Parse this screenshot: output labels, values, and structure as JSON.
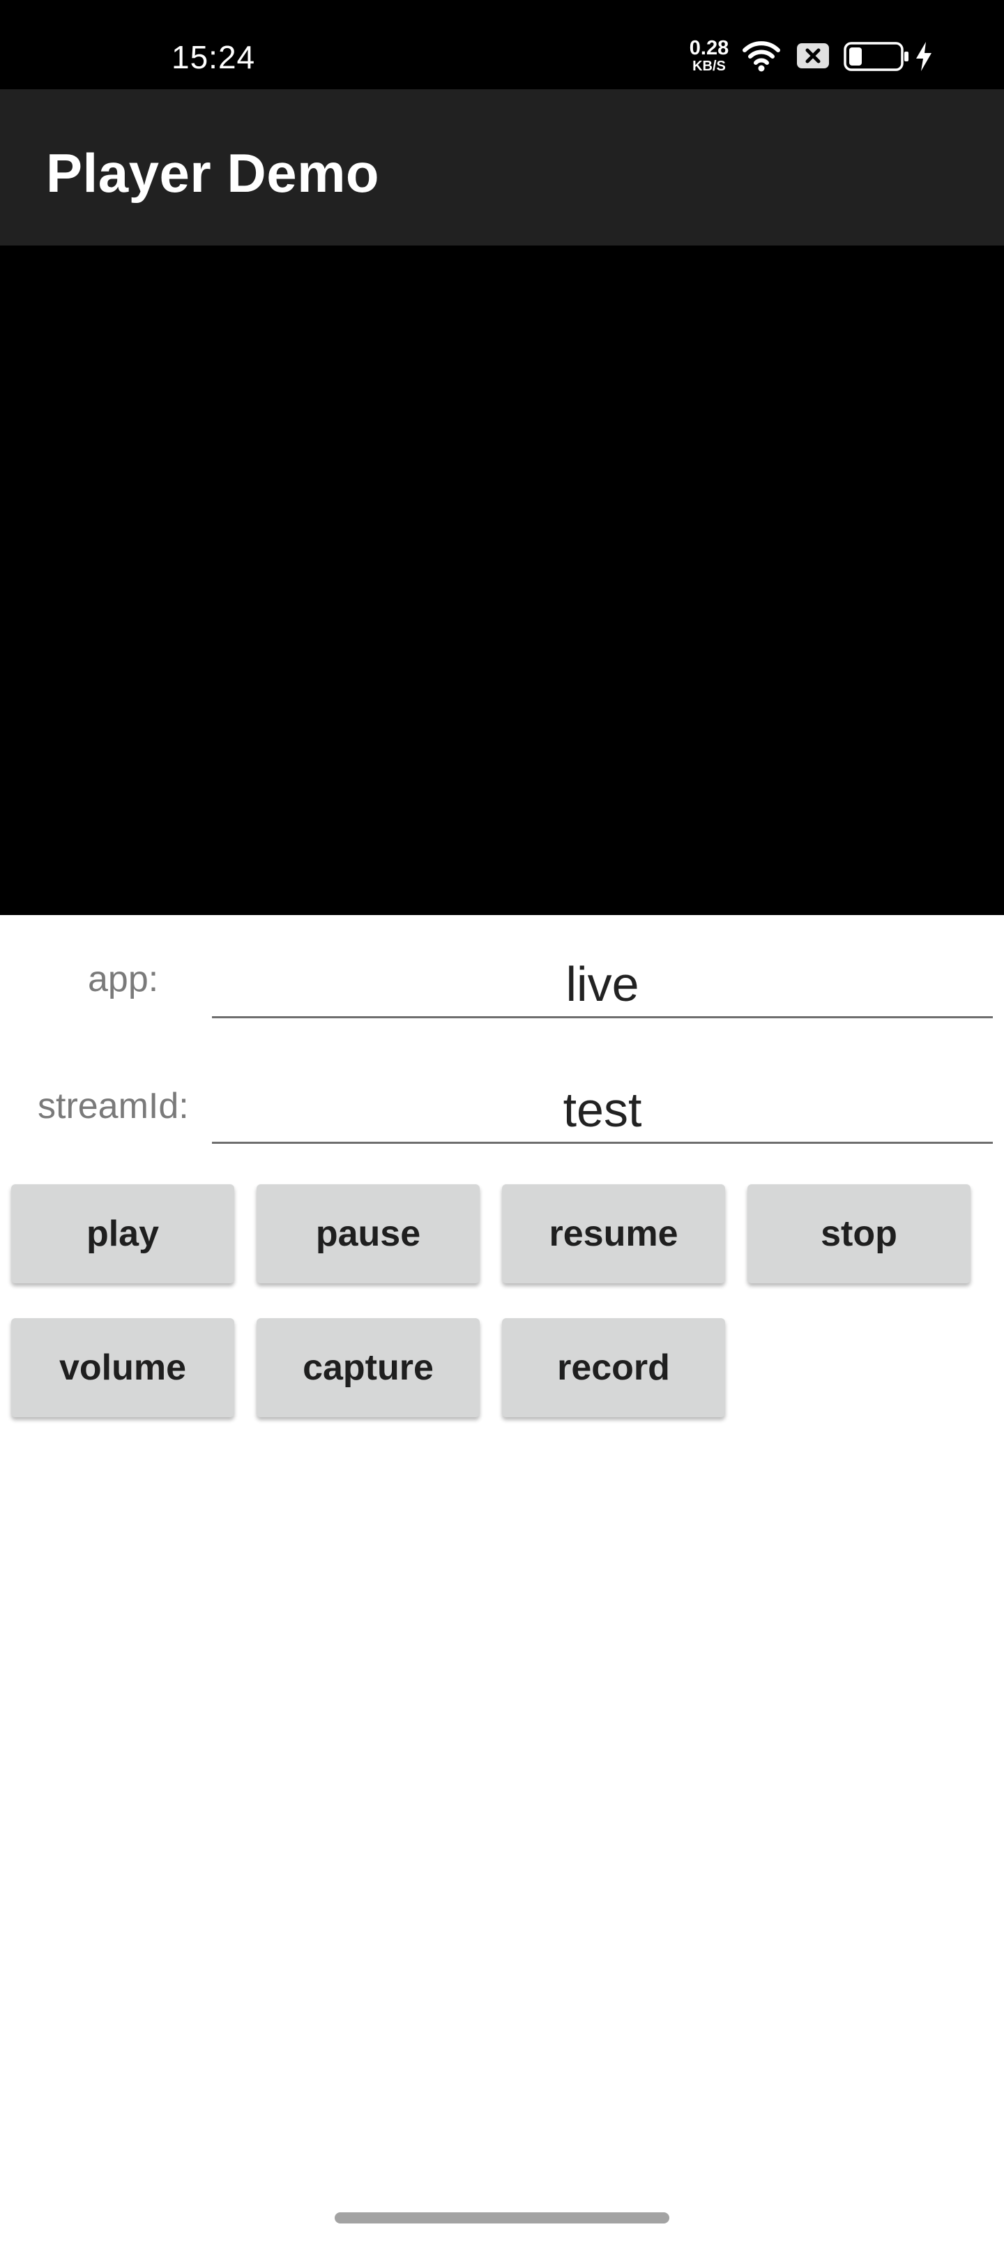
{
  "status_bar": {
    "time": "15:24",
    "net_speed_value": "0.28",
    "net_speed_unit": "KB/S",
    "icons": [
      "wifi-icon",
      "x-icon",
      "battery-icon",
      "charging-bolt-icon"
    ],
    "battery_level": 0.25
  },
  "app_bar": {
    "title": "Player Demo"
  },
  "form": {
    "app_label": "app:",
    "app_value": "live",
    "stream_label": "streamId:",
    "stream_value": "test"
  },
  "buttons": {
    "play": "play",
    "pause": "pause",
    "resume": "resume",
    "stop": "stop",
    "volume": "volume",
    "capture": "capture",
    "record": "record"
  },
  "colors": {
    "status_bar_bg": "#000000",
    "app_bar_bg": "#212121",
    "video_bg": "#000000",
    "button_bg": "#d6d7d7",
    "page_bg": "#ffffff"
  }
}
